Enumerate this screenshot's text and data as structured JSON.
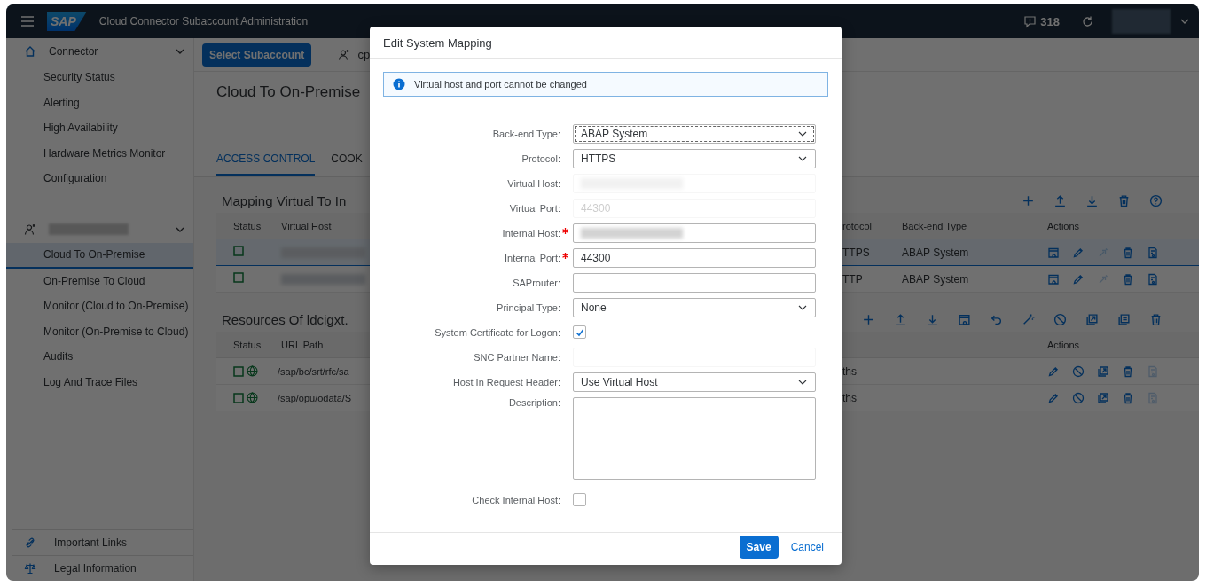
{
  "header": {
    "logo": "SAP",
    "title": "Cloud Connector Subaccount Administration",
    "notification_count": "318"
  },
  "sidebar": {
    "groups": [
      {
        "label": "Connector",
        "items": [
          {
            "label": "Security Status",
            "selected": false
          },
          {
            "label": "Alerting",
            "selected": false
          },
          {
            "label": "High Availability",
            "selected": false
          },
          {
            "label": "Hardware Metrics Monitor",
            "selected": false
          },
          {
            "label": "Configuration",
            "selected": false
          }
        ]
      },
      {
        "items": [
          {
            "label": "Cloud To On-Premise",
            "selected": true
          },
          {
            "label": "On-Premise To Cloud",
            "selected": false
          },
          {
            "label": "Monitor (Cloud to On-Premise)",
            "selected": false
          },
          {
            "label": "Monitor (On-Premise to Cloud)",
            "selected": false
          },
          {
            "label": "Audits",
            "selected": false
          },
          {
            "label": "Log And Trace Files",
            "selected": false
          }
        ]
      }
    ],
    "footer_links": [
      {
        "label": "Important Links",
        "kind": "link"
      },
      {
        "label": "Legal Information",
        "kind": "legal"
      }
    ]
  },
  "top_bar": {
    "button": "Select Subaccount",
    "user": "cp"
  },
  "page_title": "Cloud To On-Premise",
  "tabs": [
    {
      "label": "ACCESS CONTROL",
      "selected": true
    },
    {
      "label": "COOK",
      "selected": false
    }
  ],
  "mapping": {
    "title": "Mapping Virtual To In",
    "toolbar": [
      {
        "kind": "add"
      },
      {
        "kind": "upload"
      },
      {
        "kind": "download"
      },
      {
        "kind": "delete"
      },
      {
        "kind": "help"
      }
    ],
    "columns_left": [
      "Status",
      "Virtual Host"
    ],
    "columns_right": [
      "rotocol",
      "Back-end Type",
      "Actions"
    ],
    "rows": [
      {
        "selected": true,
        "protocol": "TTPS",
        "backend_type": "ABAP System",
        "actions": [
          {
            "kind": "details",
            "disabled": false
          },
          {
            "kind": "edit",
            "disabled": false
          },
          {
            "kind": "connect",
            "disabled": true
          },
          {
            "kind": "delete",
            "disabled": false
          },
          {
            "kind": "report",
            "disabled": false
          }
        ]
      },
      {
        "selected": false,
        "protocol": "TTP",
        "backend_type": "ABAP System",
        "actions": [
          {
            "kind": "details",
            "disabled": false
          },
          {
            "kind": "edit",
            "disabled": false
          },
          {
            "kind": "connect",
            "disabled": true
          },
          {
            "kind": "delete",
            "disabled": false
          },
          {
            "kind": "report",
            "disabled": false
          }
        ]
      }
    ]
  },
  "resources": {
    "title": "Resources Of ldcigxt.",
    "toolbar": [
      {
        "kind": "add"
      },
      {
        "kind": "upload"
      },
      {
        "kind": "download"
      },
      {
        "kind": "details"
      },
      {
        "kind": "undo"
      },
      {
        "kind": "wand"
      },
      {
        "kind": "block"
      },
      {
        "kind": "import"
      },
      {
        "kind": "export"
      },
      {
        "kind": "delete"
      }
    ],
    "columns_left": [
      "Status",
      "URL Path"
    ],
    "columns_right": [
      "Actions"
    ],
    "rows": [
      {
        "url_path": "/sap/bc/srt/rfc/sa",
        "column_3": "ths",
        "actions": [
          {
            "kind": "edit",
            "disabled": false
          },
          {
            "kind": "block",
            "disabled": false
          },
          {
            "kind": "import",
            "disabled": false
          },
          {
            "kind": "delete",
            "disabled": false
          },
          {
            "kind": "report",
            "disabled": true
          }
        ]
      },
      {
        "url_path": "/sap/opu/odata/S",
        "column_3": "ths",
        "actions": [
          {
            "kind": "edit",
            "disabled": false
          },
          {
            "kind": "block",
            "disabled": false
          },
          {
            "kind": "import",
            "disabled": false
          },
          {
            "kind": "delete",
            "disabled": false
          },
          {
            "kind": "report",
            "disabled": true
          }
        ]
      }
    ]
  },
  "dialog": {
    "title": "Edit System Mapping",
    "info": "Virtual host and port cannot be changed",
    "fields": [
      {
        "label": "Back-end Type:",
        "kind": "select",
        "value": "ABAP System",
        "focused": true
      },
      {
        "label": "Protocol:",
        "kind": "select",
        "value": "HTTPS"
      },
      {
        "label": "Virtual Host:",
        "kind": "input",
        "redacted": true,
        "disabled": true
      },
      {
        "label": "Virtual Port:",
        "kind": "input",
        "value": "44300",
        "disabled": true
      },
      {
        "label": "Internal Host:",
        "kind": "input",
        "redacted": true,
        "required": true
      },
      {
        "label": "Internal Port:",
        "kind": "input",
        "value": "44300",
        "required": true
      },
      {
        "label": "SAProuter:",
        "kind": "input"
      },
      {
        "label": "Principal Type:",
        "kind": "select",
        "value": "None"
      },
      {
        "label": "System Certificate for Logon:",
        "kind": "checkbox",
        "checked": true
      },
      {
        "label": "SNC Partner Name:",
        "kind": "input",
        "disabled": true
      },
      {
        "label": "Host In Request Header:",
        "kind": "select",
        "value": "Use Virtual Host"
      },
      {
        "label": "Description:",
        "kind": "textarea"
      },
      {
        "label": "Check Internal Host:",
        "kind": "checkbox",
        "checked": false
      }
    ],
    "buttons": {
      "save": "Save",
      "cancel": "Cancel"
    }
  }
}
